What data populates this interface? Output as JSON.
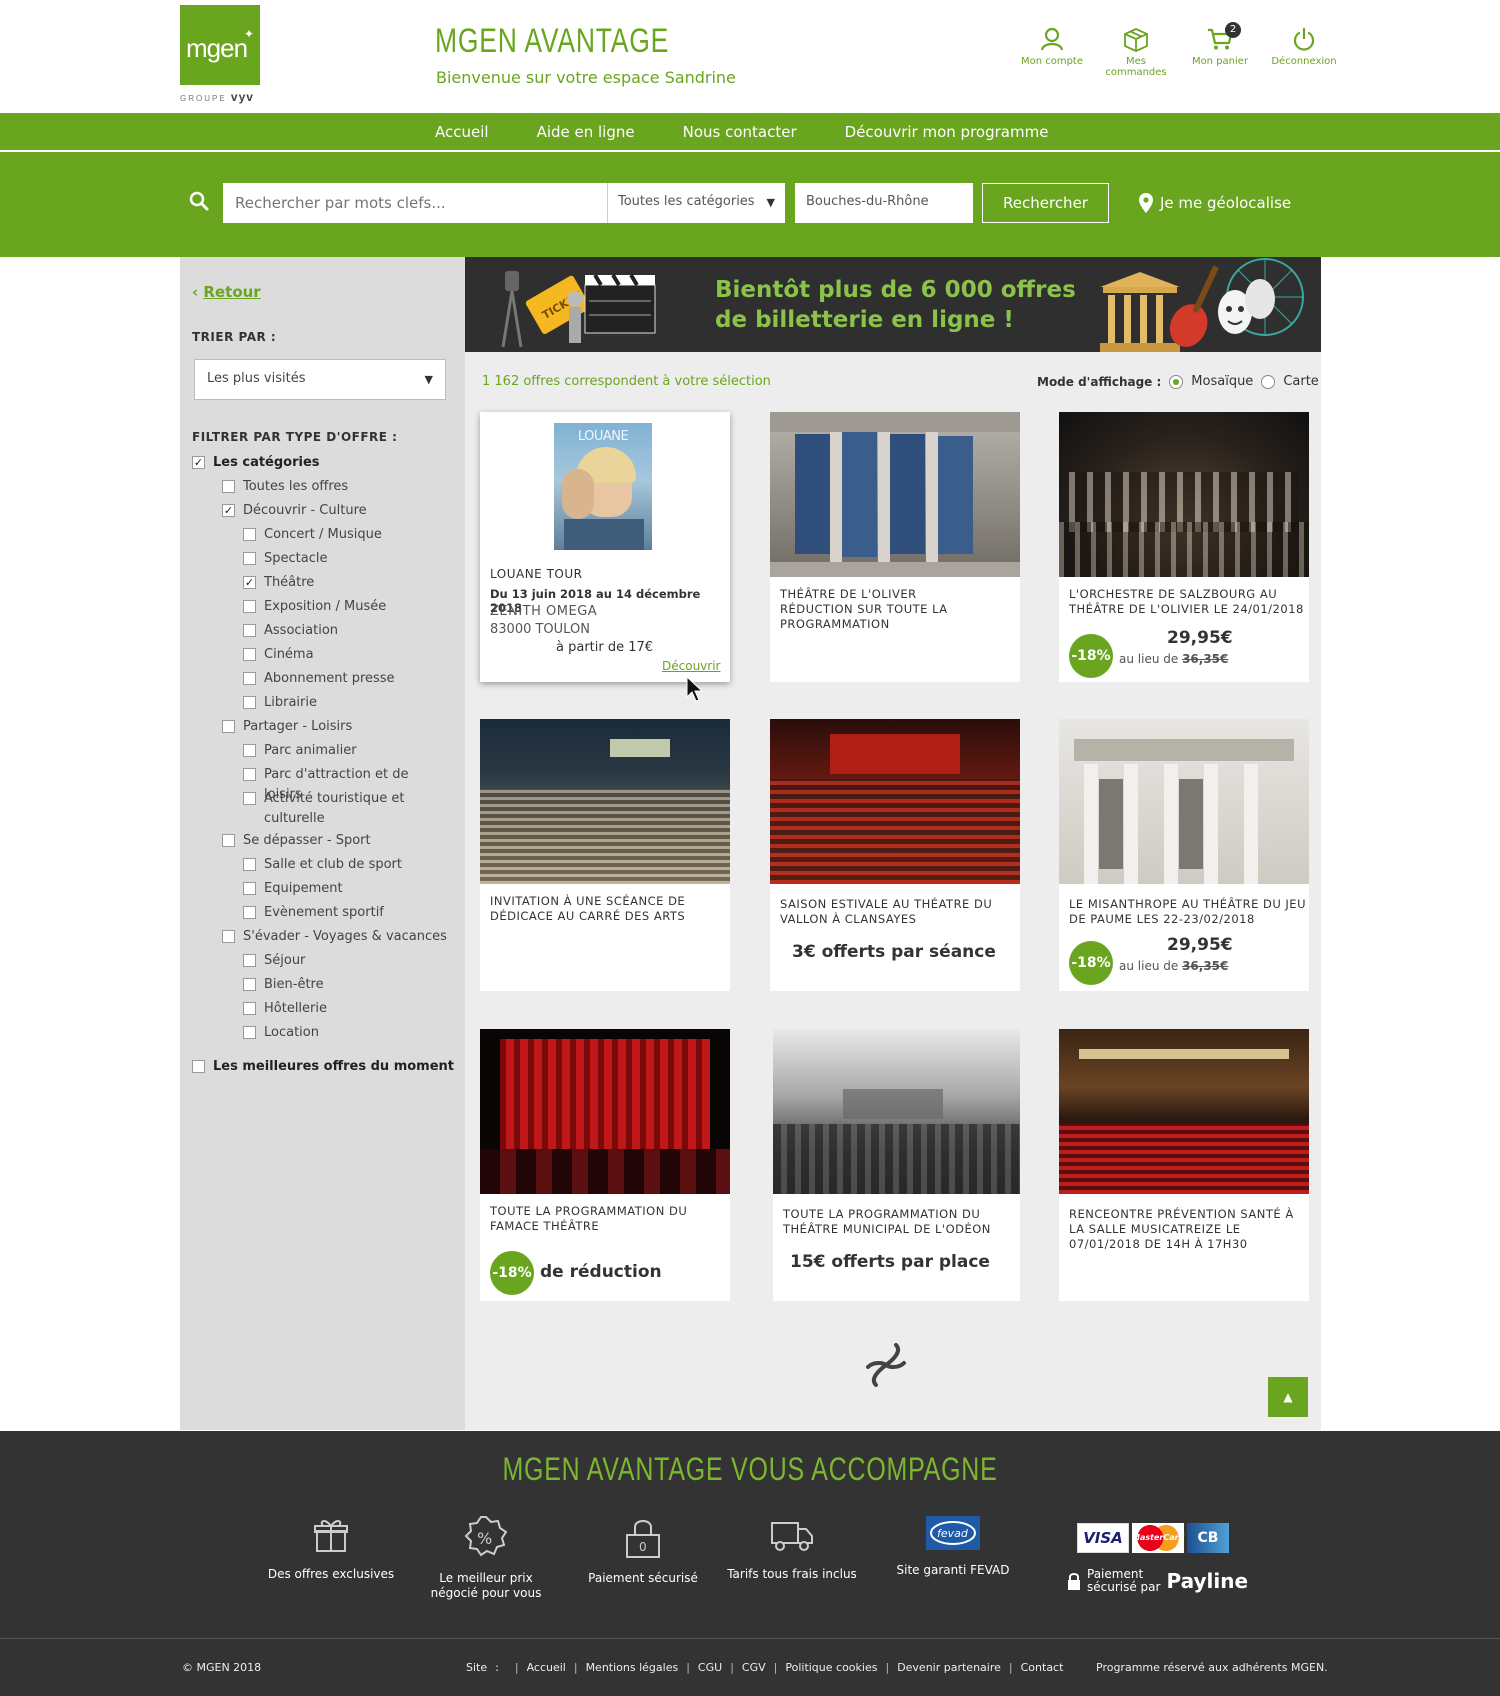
{
  "header": {
    "logo_text": "mgen",
    "logo_sub_prefix": "GROUPE",
    "logo_sub_brand": "vyv",
    "brand_title": "MGEN AVANTAGE",
    "welcome": "Bienvenue sur votre espace Sandrine",
    "actions": [
      {
        "label": "Mon compte",
        "icon": "user-icon"
      },
      {
        "label": "Mes commandes",
        "icon": "box-icon"
      },
      {
        "label": "Mon panier",
        "icon": "cart-icon",
        "badge": "2"
      },
      {
        "label": "Déconnexion",
        "icon": "power-icon"
      }
    ]
  },
  "nav": {
    "items": [
      "Accueil",
      "Aide en ligne",
      "Nous contacter",
      "Découvrir mon programme"
    ]
  },
  "search": {
    "placeholder": "Rechercher par mots clefs...",
    "category": "Toutes les catégories",
    "location": "Bouches-du-Rhône",
    "button": "Rechercher",
    "geolocate": "Je me géolocalise"
  },
  "sidebar": {
    "back": "Retour",
    "sort_title": "TRIER PAR :",
    "sort_value": "Les plus visités",
    "filter_title": "FILTRER PAR TYPE D'OFFRE :",
    "filters": [
      {
        "label": "Les catégories",
        "checked": true,
        "level": 0,
        "bold": true
      },
      {
        "label": "Toutes les offres",
        "checked": false,
        "level": 1
      },
      {
        "label": "Découvrir - Culture",
        "checked": true,
        "level": 1
      },
      {
        "label": "Concert / Musique",
        "checked": false,
        "level": 2
      },
      {
        "label": "Spectacle",
        "checked": false,
        "level": 2
      },
      {
        "label": "Théâtre",
        "checked": true,
        "level": 2
      },
      {
        "label": "Exposition / Musée",
        "checked": false,
        "level": 2
      },
      {
        "label": "Association",
        "checked": false,
        "level": 2
      },
      {
        "label": "Cinéma",
        "checked": false,
        "level": 2
      },
      {
        "label": "Abonnement presse",
        "checked": false,
        "level": 2
      },
      {
        "label": "Librairie",
        "checked": false,
        "level": 2
      },
      {
        "label": "Partager - Loisirs",
        "checked": false,
        "level": 1
      },
      {
        "label": "Parc animalier",
        "checked": false,
        "level": 2
      },
      {
        "label": "Parc d'attraction et de loisirs",
        "checked": false,
        "level": 2
      },
      {
        "label": "Activité touristique et culturelle",
        "checked": false,
        "level": 2
      },
      {
        "label": "Se dépasser - Sport",
        "checked": false,
        "level": 1
      },
      {
        "label": "Salle et club de sport",
        "checked": false,
        "level": 2
      },
      {
        "label": "Equipement",
        "checked": false,
        "level": 2
      },
      {
        "label": "Evènement sportif",
        "checked": false,
        "level": 2
      },
      {
        "label": "S'évader - Voyages & vacances",
        "checked": false,
        "level": 1
      },
      {
        "label": "Séjour",
        "checked": false,
        "level": 2
      },
      {
        "label": "Bien-être",
        "checked": false,
        "level": 2
      },
      {
        "label": "Hôtellerie",
        "checked": false,
        "level": 2
      },
      {
        "label": "Location",
        "checked": false,
        "level": 2
      },
      {
        "label": "Les meilleures offres du moment",
        "checked": false,
        "level": 0,
        "bold": true
      }
    ]
  },
  "main": {
    "banner_line1": "Bientôt plus de 6 000 offres",
    "banner_line2": "de billetterie en ligne !",
    "results_count": "1 162 offres correspondent à votre sélection",
    "display_label": "Mode d'affichage :",
    "display_options": [
      "Mosaïque",
      "Carte"
    ],
    "display_selected": "Mosaïque"
  },
  "cards": [
    {
      "title": "LOUANE TOUR",
      "dates": "Du 13 juin 2018 au 14 décembre 2018",
      "venue": "ZENITH OMEGA",
      "city": "83000 TOULON",
      "from": "à partir de 17€",
      "link": "Découvrir",
      "poster_text": "LOUANE"
    },
    {
      "title": "THÉÂTRE DE L'OLIVER RÉDUCTION SUR TOUTE LA PROGRAMMATION"
    },
    {
      "title": "L'ORCHESTRE DE SALZBOURG AU THÉÂTRE DE L'OLIVIER LE 24/01/2018",
      "badge": "-18%",
      "price": "29,95€",
      "was_prefix": "au lieu de",
      "was": "36,35€"
    },
    {
      "title": "INVITATION À UNE SCÉANCE DE DÉDICACE AU CARRÉ DES ARTS"
    },
    {
      "title": "SAISON ESTIVALE AU THÉATRE DU VALLON À CLANSAYES",
      "promo": "3€ offerts par séance"
    },
    {
      "title": "LE MISANTHROPE AU THÉÂTRE DU JEU DE PAUME LES 22-23/02/2018",
      "badge": "-18%",
      "price": "29,95€",
      "was_prefix": "au lieu de",
      "was": "36,35€"
    },
    {
      "title": "TOUTE LA PROGRAMMATION DU FAMACE THÉÂTRE",
      "badge": "-18%",
      "promo": "de réduction"
    },
    {
      "title": "TOUTE LA PROGRAMMATION DU THÉÂTRE MUNICIPAL DE L'ODÉON",
      "promo": "15€ offerts par place"
    },
    {
      "title": "RENCEONTRE PRÉVENTION SANTÉ À LA SALLE MUSICATREIZE LE 07/01/2018 DE 14H À 17H30"
    }
  ],
  "footer": {
    "title": "MGEN AVANTAGE VOUS ACCOMPAGNE",
    "features": [
      {
        "label": "Des offres exclusives",
        "icon": "gift-icon"
      },
      {
        "label": "Le meilleur prix négocié pour vous",
        "icon": "percent-badge-icon"
      },
      {
        "label": "Paiement sécurisé",
        "icon": "padlock-icon"
      },
      {
        "label": "Tarifs tous frais inclus",
        "icon": "truck-icon"
      },
      {
        "label": "Site garanti FEVAD",
        "icon": "fevad-logo"
      }
    ],
    "payment_line1": "Paiement",
    "payment_line2": "sécurisé par",
    "payline": "Payline",
    "card_logos": [
      "VISA",
      "MasterCard",
      "CB"
    ],
    "fevad_logo_text": "fevad",
    "padlock_digit": "0",
    "copyright": "© MGEN 2018",
    "links": [
      "Site",
      ":",
      "Accueil",
      "Mentions légales",
      "CGU",
      "CGV",
      "Politique cookies",
      "Devenir partenaire",
      "Contact"
    ],
    "reserved": "Programme réservé aux adhérents MGEN."
  },
  "colors": {
    "brand_green": "#6aa520",
    "footer_dark": "#333333",
    "sidebar_gray": "#dcdcdc",
    "main_bg": "#ededed"
  }
}
